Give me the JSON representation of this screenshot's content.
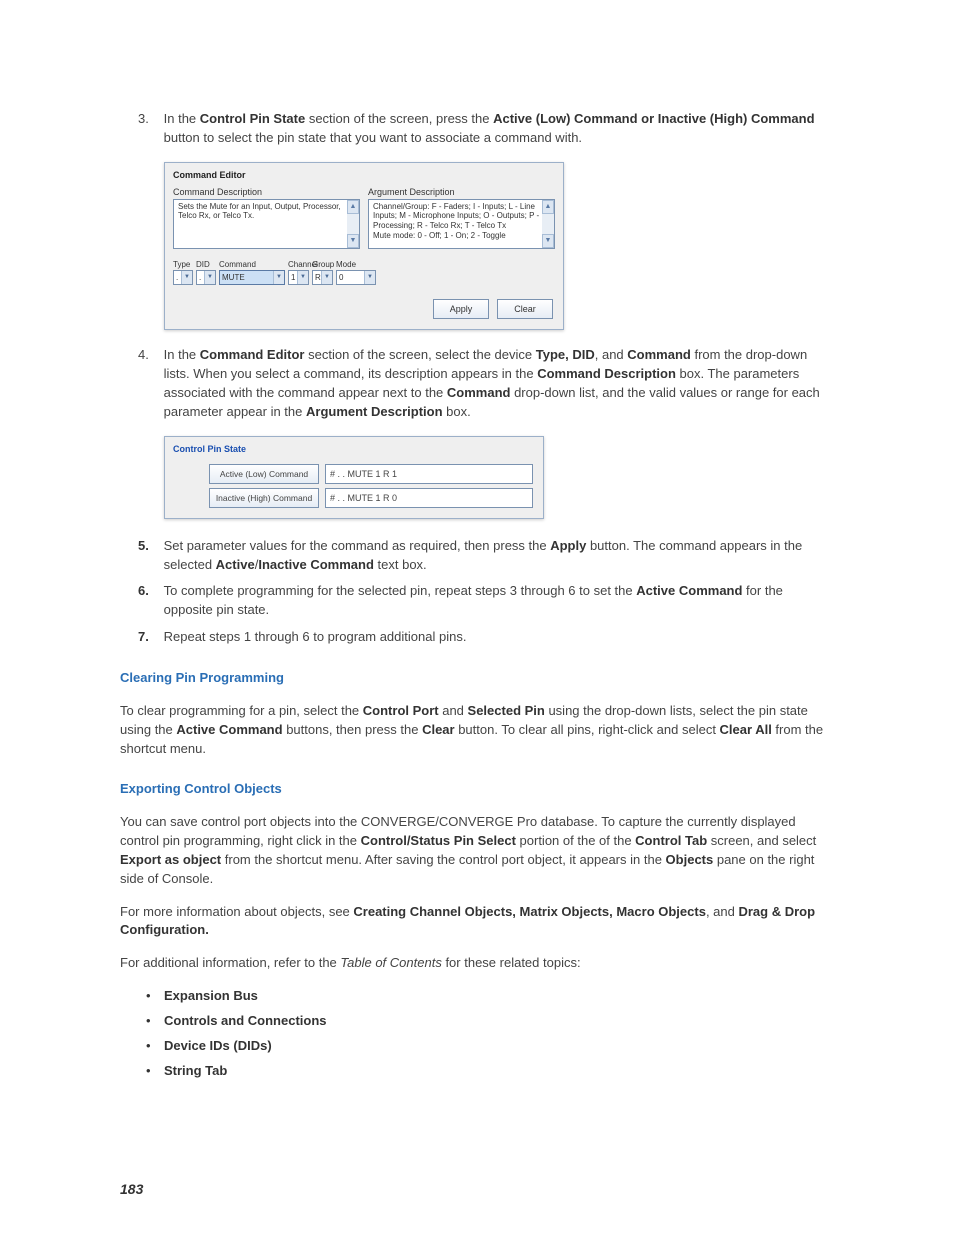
{
  "step3": {
    "num": "3.",
    "t1": "In the ",
    "b1": "Control Pin State",
    "t2": " section of the screen, press the ",
    "b2": "Active (Low) Command or Inactive (High) Command",
    "t3": " button to select the pin state that you want to associate a command with."
  },
  "ss1": {
    "title": "Command Editor",
    "lbl_cmd_desc": "Command Description",
    "lbl_arg_desc": "Argument Description",
    "cmd_desc": "Sets the Mute for an Input, Output, Processor, Telco Rx, or Telco Tx.",
    "arg_desc": "Channel/Group: F - Faders; I - Inputs; L - Line Inputs; M - Microphone Inputs; O - Outputs; P - Processing; R - Telco Rx; T - Telco Tx\nMute mode: 0 - Off; 1 - On; 2 - Toggle",
    "lbl_type": "Type",
    "lbl_did": "DID",
    "lbl_command": "Command",
    "lbl_channel": "Channel",
    "lbl_group": "Group",
    "lbl_mode": "Mode",
    "val_type": ".",
    "val_did": ".",
    "val_command": "MUTE",
    "val_channel": "1",
    "val_group": "R",
    "val_mode": "0",
    "btn_apply": "Apply",
    "btn_clear": "Clear"
  },
  "step4": {
    "num": "4.",
    "t1": "In the ",
    "b1": "Command Editor",
    "t2": " section of the screen, select the device ",
    "b2": "Type, DID",
    "t3": ", and ",
    "b3": "Command",
    "t4": " from the drop-down lists. When you select a command, its description appears in the ",
    "b4": "Command Description",
    "t5": " box. The parameters associated with the command appear next to the ",
    "b5": "Command",
    "t6": " drop-down list, and the valid values or range for each parameter appear in the ",
    "b6": "Argument Description",
    "t7": " box."
  },
  "ss2": {
    "title": "Control Pin State",
    "btn_active": "Active (Low) Command",
    "btn_inactive": "Inactive (High) Command",
    "val_active": "# . . MUTE 1 R 1",
    "val_inactive": "# . . MUTE 1 R 0"
  },
  "step5": {
    "num": "5.",
    "t1": "Set parameter values for the command as required, then press the ",
    "b1": "Apply",
    "t2": " button. The command appears in the selected ",
    "b2": "Active",
    "t3": "/",
    "b3": "Inactive Command",
    "t4": " text box."
  },
  "step6": {
    "num": "6.",
    "t1": "To complete programming for the selected pin, repeat steps 3 through 6 to set the ",
    "b1": "Active Command",
    "t2": " for the opposite pin state."
  },
  "step7": {
    "num": "7.",
    "t1": "Repeat steps 1 through 6 to program additional pins."
  },
  "h_clearing": "Clearing Pin Programming",
  "p_clearing": {
    "t1": "To clear programming for a pin, select the ",
    "b1": "Control Port",
    "t2": " and ",
    "b2": "Selected Pin",
    "t3": " using the drop-down lists, select the pin state using the ",
    "b3": "Active Command",
    "t4": " buttons, then press the ",
    "b4": "Clear",
    "t5": " button. To clear all pins, right-click and select ",
    "b5": "Clear All",
    "t6": " from the shortcut menu."
  },
  "h_exporting": "Exporting Control Objects",
  "p_export1": {
    "t1": "You can save control port objects into the CONVERGE/CONVERGE Pro database. To capture the currently displayed control pin programming, right click in the ",
    "b1": "Control/Status Pin Select",
    "t2": " portion of the of the ",
    "b2": "Control Tab",
    "t3": " screen, and select ",
    "b3": "Export as object",
    "t4": " from the shortcut menu. After saving the control port object, it appears in the ",
    "b4": "Objects",
    "t5": " pane on the right side of Console."
  },
  "p_export2": {
    "t1": "For more information about objects, see ",
    "b1": "Creating Channel Objects, Matrix Objects, Macro Objects",
    "t2": ", and ",
    "b2": "Drag & Drop Configuration."
  },
  "p_addinfo": {
    "t1": "For additional information, refer to the ",
    "i1": "Table of Contents",
    "t2": " for these related topics:"
  },
  "bullets": {
    "b1": "Expansion Bus",
    "b2": "Controls and Connections",
    "b3": "Device IDs (DIDs)",
    "b4": "String Tab"
  },
  "page_number": "183"
}
